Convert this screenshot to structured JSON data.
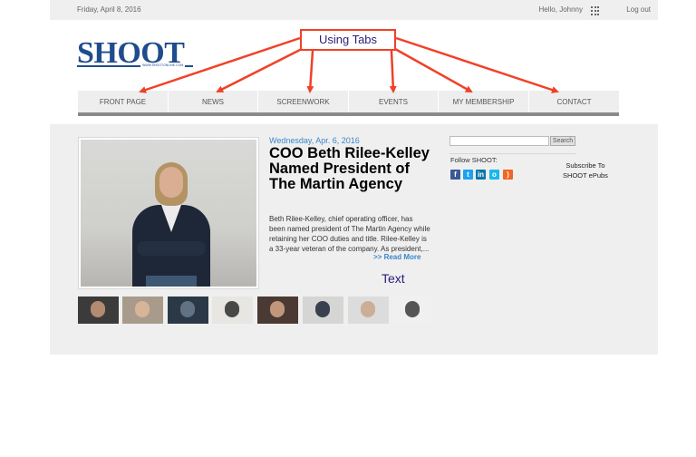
{
  "topbar": {
    "date": "Friday, April 8, 2016",
    "greeting": "Hello, Johnny",
    "logout": "Log out"
  },
  "header": {
    "logo": "SHOOT",
    "tagline": "WWW.SHOOTONLINE.COM"
  },
  "annotations": {
    "callout": "Using Tabs",
    "text_label": "Text",
    "accent_color": "#f04127"
  },
  "nav": {
    "tabs": [
      {
        "label": "FRONT PAGE"
      },
      {
        "label": "NEWS"
      },
      {
        "label": "SCREENWORK"
      },
      {
        "label": "EVENTS"
      },
      {
        "label": "MY MEMBERSHIP"
      },
      {
        "label": "CONTACT"
      }
    ]
  },
  "article": {
    "date": "Wednesday, Apr. 6, 2016",
    "headline": "COO Beth Rilee-Kelley Named President of The Martin Agency",
    "teaser": "Beth Rilee-Kelley, chief operating officer, has been named president of The Martin Agency while retaining her COO duties and title. Rilee-Kelley is a 33-year veteran of the company. As president,...",
    "read_more": ">> Read More"
  },
  "sidebar": {
    "search_placeholder": "",
    "search_button": "Search",
    "follow_label": "Follow SHOOT:",
    "social_icons": [
      {
        "icon": "facebook-icon",
        "glyph": "f",
        "color": "#3b5998"
      },
      {
        "icon": "twitter-icon",
        "glyph": "t",
        "color": "#1da1f2"
      },
      {
        "icon": "linkedin-icon",
        "glyph": "in",
        "color": "#0e76a8"
      },
      {
        "icon": "vimeo-icon",
        "glyph": "o",
        "color": "#1ab7ea"
      },
      {
        "icon": "rss-icon",
        "glyph": ")",
        "color": "#f26522"
      }
    ],
    "subscribe": "Subscribe To SHOOT ePubs"
  },
  "thumbnails": [
    {
      "color": "#3b3b3b",
      "accent": "#c89a7a"
    },
    {
      "color": "#a89b8c",
      "accent": "#e0b89a"
    },
    {
      "color": "#2b3947",
      "accent": "#6b7d8e"
    },
    {
      "color": "#e8e6e3",
      "accent": "#2b2b2b"
    },
    {
      "color": "#4a3a33",
      "accent": "#d6a88a"
    },
    {
      "color": "#d5d5d3",
      "accent": "#1d2737"
    },
    {
      "color": "#dcdcdc",
      "accent": "#c9a48a"
    },
    {
      "color": "#f0f0f0",
      "accent": "#3a3a3a"
    },
    {
      "color": "#6e7f95",
      "accent": "#3a2c28"
    }
  ]
}
